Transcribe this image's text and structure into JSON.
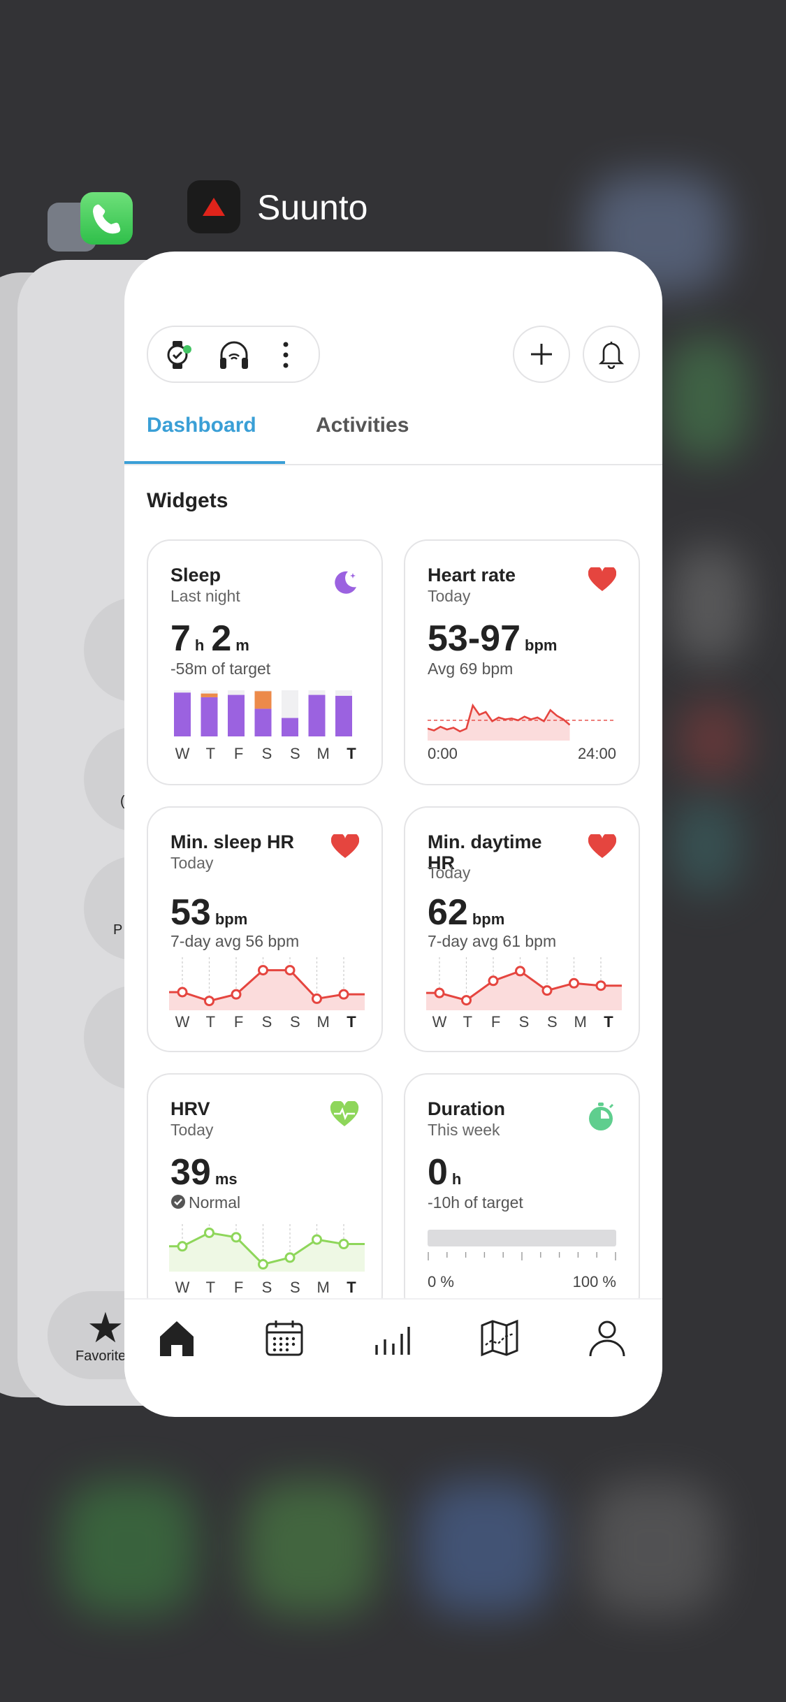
{
  "switcher": {
    "app_title": "Suunto"
  },
  "background_app": {
    "favorites_label": "Favorites",
    "letter_p": "P",
    "letter_c": "("
  },
  "header": {
    "left_icons": [
      "watch-connected-icon",
      "headphones-icon",
      "more-vertical-icon"
    ],
    "right_icons": [
      "plus-icon",
      "bell-icon"
    ],
    "status_dot_color": "#43c463"
  },
  "tabs": [
    {
      "label": "Dashboard",
      "active": true
    },
    {
      "label": "Activities",
      "active": false
    }
  ],
  "section_title": "Widgets",
  "widgets": {
    "sleep": {
      "title": "Sleep",
      "subtitle": "Last night",
      "hours": "7",
      "hours_unit": "h",
      "minutes": "2",
      "minutes_unit": "m",
      "note": "-58m of target",
      "icon": "moon-icon",
      "accent": "#9b62e0"
    },
    "heart_rate": {
      "title": "Heart rate",
      "subtitle": "Today",
      "value": "53-97",
      "unit": "bpm",
      "note": "Avg 69 bpm",
      "x_start": "0:00",
      "x_end": "24:00",
      "icon": "heart-icon",
      "accent": "#e5453f"
    },
    "min_sleep_hr": {
      "title": "Min. sleep HR",
      "subtitle": "Today",
      "value": "53",
      "unit": "bpm",
      "note": "7-day avg 56 bpm",
      "icon": "heart-icon"
    },
    "min_daytime_hr": {
      "title": "Min. daytime HR",
      "subtitle": "Today",
      "value": "62",
      "unit": "bpm",
      "note": "7-day avg 61 bpm",
      "icon": "heart-icon"
    },
    "hrv": {
      "title": "HRV",
      "subtitle": "Today",
      "value": "39",
      "unit": "ms",
      "note": "Normal",
      "icon": "heart-pulse-icon",
      "accent": "#8ed65a"
    },
    "duration": {
      "title": "Duration",
      "subtitle": "This week",
      "value": "0",
      "unit": "h",
      "note": "-10h of target",
      "progress": 0,
      "x_start": "0 %",
      "x_end": "100 %",
      "icon": "stopwatch-icon",
      "accent": "#5fce8e"
    }
  },
  "days": [
    "W",
    "T",
    "F",
    "S",
    "S",
    "M",
    "T"
  ],
  "tabbar": [
    "home-icon",
    "calendar-icon",
    "chart-bars-icon",
    "map-icon",
    "profile-icon"
  ],
  "chart_data": [
    {
      "type": "bar",
      "title": "Sleep",
      "categories": [
        "W",
        "T",
        "F",
        "S",
        "S",
        "M",
        "T"
      ],
      "series": [
        {
          "values": [
            0.95,
            0.85,
            0.9,
            0.6,
            0.4,
            0.9,
            0.88
          ],
          "color": "#9b62e0"
        },
        {
          "values": [
            0,
            0.08,
            0,
            0.38,
            0,
            0,
            0
          ],
          "color": "#ec8a4a"
        }
      ],
      "target": 1.0
    },
    {
      "type": "line",
      "title": "Min. sleep HR",
      "categories": [
        "W",
        "T",
        "F",
        "S",
        "S",
        "M",
        "T"
      ],
      "values": [
        56,
        52,
        55,
        66,
        66,
        53,
        55
      ],
      "ylim": [
        49,
        70
      ]
    },
    {
      "type": "line",
      "title": "Min. daytime HR",
      "categories": [
        "W",
        "T",
        "F",
        "S",
        "S",
        "M",
        "T"
      ],
      "values": [
        59,
        56,
        64,
        68,
        60,
        63,
        62
      ],
      "ylim": [
        53,
        72
      ]
    },
    {
      "type": "line",
      "title": "HRV",
      "categories": [
        "W",
        "T",
        "F",
        "S",
        "S",
        "M",
        "T"
      ],
      "values": [
        44,
        50,
        48,
        36,
        39,
        47,
        45
      ],
      "ylim": [
        34,
        52
      ]
    },
    {
      "type": "area",
      "title": "Heart rate",
      "x": [
        0,
        1,
        2,
        3,
        4,
        5,
        6,
        7,
        8,
        9,
        10,
        11,
        12,
        13,
        14,
        15,
        16,
        17,
        18,
        19,
        20,
        21,
        22,
        23,
        24
      ],
      "values": [
        60,
        58,
        62,
        59,
        61,
        57,
        60,
        85,
        75,
        78,
        68,
        72,
        70,
        71,
        69,
        73,
        70,
        72,
        68,
        80,
        74,
        70,
        64,
        0,
        0
      ],
      "avg": 69
    }
  ]
}
